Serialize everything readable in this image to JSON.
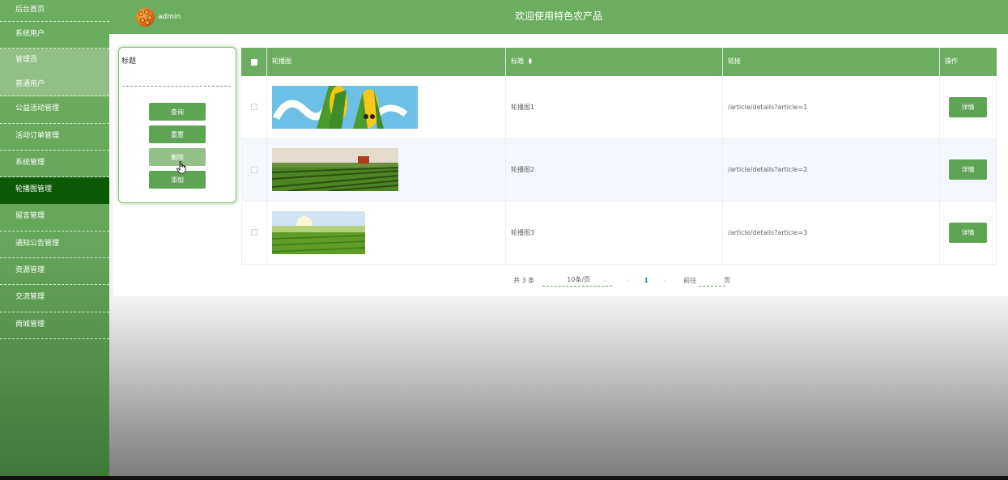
{
  "sidebar": {
    "items": [
      {
        "label": "后台首页"
      },
      {
        "label": "系统用户"
      },
      {
        "label": "管理员"
      },
      {
        "label": "普通用户"
      },
      {
        "label": "公益活动管理"
      },
      {
        "label": "活动订单管理"
      },
      {
        "label": "系统管理"
      },
      {
        "label": "轮播图管理"
      },
      {
        "label": "留言管理"
      },
      {
        "label": "通知公告管理"
      },
      {
        "label": "资源管理"
      },
      {
        "label": "交流管理"
      },
      {
        "label": "商城管理"
      }
    ]
  },
  "header": {
    "username": "admin",
    "title": "欢迎使用特色农产品"
  },
  "search": {
    "label": "标题",
    "placeholder": "",
    "buttons": {
      "query": "查询",
      "reset": "重置",
      "delete": "删除",
      "add": "添加"
    }
  },
  "table": {
    "columns": {
      "image": "轮播图",
      "title": "标题",
      "link": "链接",
      "action": "操作"
    },
    "rows": [
      {
        "title": "轮播图1",
        "link": "/article/details?article=1",
        "action": "详情"
      },
      {
        "title": "轮播图2",
        "link": "/article/details?article=2",
        "action": "详情"
      },
      {
        "title": "轮播图3",
        "link": "/article/details?article=3",
        "action": "详情"
      }
    ]
  },
  "pagination": {
    "total": "共 3 条",
    "page_size": "10条/页",
    "current": "1",
    "goto_prefix": "前往",
    "goto_suffix": "页",
    "prev_icon": "chevron-left",
    "next_icon": "chevron-right"
  },
  "colors": {
    "primary": "#6cae5f",
    "button": "#5da553",
    "active_menu": "#0d5a06"
  }
}
